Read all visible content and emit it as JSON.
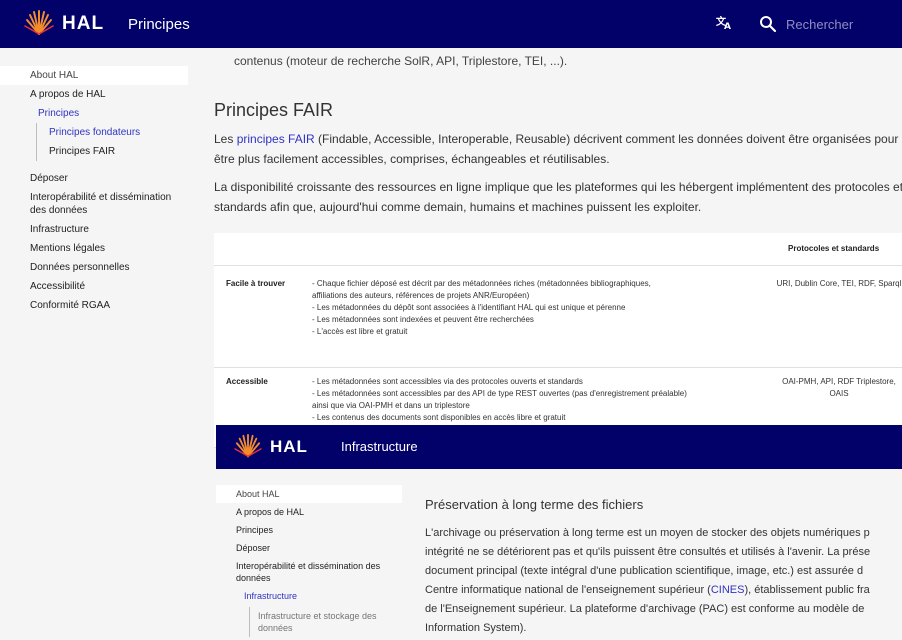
{
  "main": {
    "header": {
      "logo_text": "HAL",
      "page_title": "Principes",
      "translate_icon": "translate-icon",
      "search_placeholder": "Rechercher"
    },
    "sidebar": {
      "items": [
        "About HAL",
        "A propos de HAL",
        "Principes",
        "Principes fondateurs",
        "Principes FAIR",
        "Déposer",
        "Interopérabilité et dissémination des données",
        "Infrastructure",
        "Mentions légales",
        "Données personnelles",
        "Accessibilité",
        "Conformité RGAA"
      ]
    },
    "content": {
      "lead": "contenus (moteur de recherche SolR, API, Triplestore, TEI, ...).",
      "heading": "Principes FAIR",
      "para1_before": "Les ",
      "para1_link": "principes FAIR",
      "para1_after": " (Findable, Accessible, Interoperable, Reusable) décrivent comment les données doivent être organisées pour être plus facilement accessibles, comprises, échangeables et réutilisables.",
      "para2": "La disponibilité croissante des ressources en ligne implique que les plateformes qui les hébergent implémentent des protocoles et standards afin que, aujourd'hui comme demain, humains et machines puissent les exploiter.",
      "table": {
        "header_protocols": "Protocoles et standards",
        "rows": [
          {
            "name": "Facile à trouver",
            "desc": [
              "- Chaque fichier déposé est décrit par des métadonnées riches (métadonnées bibliographiques,",
              "affiliations des auteurs, références de projets ANR/Européen)",
              "- Les métadonnées du dépôt sont associées à l'identifiant HAL qui est unique et pérenne",
              "- Les métadonnées sont indexées et peuvent être recherchées",
              "- L'accès est libre et gratuit"
            ],
            "protocols": "URI, Dublin Core, TEI, RDF, Sparql"
          },
          {
            "name": "Accessible",
            "desc": [
              "- Les métadonnées sont accessibles via des protocoles ouverts et standards",
              "- Les métadonnées sont accessibles par des API de type REST ouvertes (pas d'enregistrement préalable)",
              "ainsi que via OAI-PMH et dans un triplestore",
              "- Les contenus des documents sont disponibles en accès libre et gratuit"
            ],
            "protocols": "OAI-PMH, API, RDF Triplestore, OAIS"
          }
        ]
      }
    }
  },
  "overlay": {
    "header": {
      "logo_text": "HAL",
      "page_title": "Infrastructure"
    },
    "sidebar": {
      "items": [
        "About HAL",
        "A propos de HAL",
        "Principes",
        "Déposer",
        "Interopérabilité et dissémination des données",
        "Infrastructure",
        "Infrastructure et stockage des données"
      ]
    },
    "content": {
      "heading": "Préservation à long terme des fichiers",
      "lines": [
        "L'archivage ou préservation à long terme est un moyen de stocker des objets numériques p",
        "intégrité ne se détériorent pas et qu'ils puissent être consultés et utilisés à l'avenir. La prése",
        "document principal (texte intégral d'une publication scientifique, image, etc.) est assurée d",
        "Centre informatique national de l'enseignement supérieur (",
        "de l'Enseignement supérieur. La plateforme d'archivage (PAC) est conforme au modèle de",
        "Information System)."
      ],
      "cines_link": "CINES",
      "line4_after": "), établissement public fra"
    }
  },
  "colors": {
    "header_bg": "#020069",
    "link": "#3033c2",
    "logo_orange": "#f28c28",
    "logo_red": "#e5323b"
  }
}
